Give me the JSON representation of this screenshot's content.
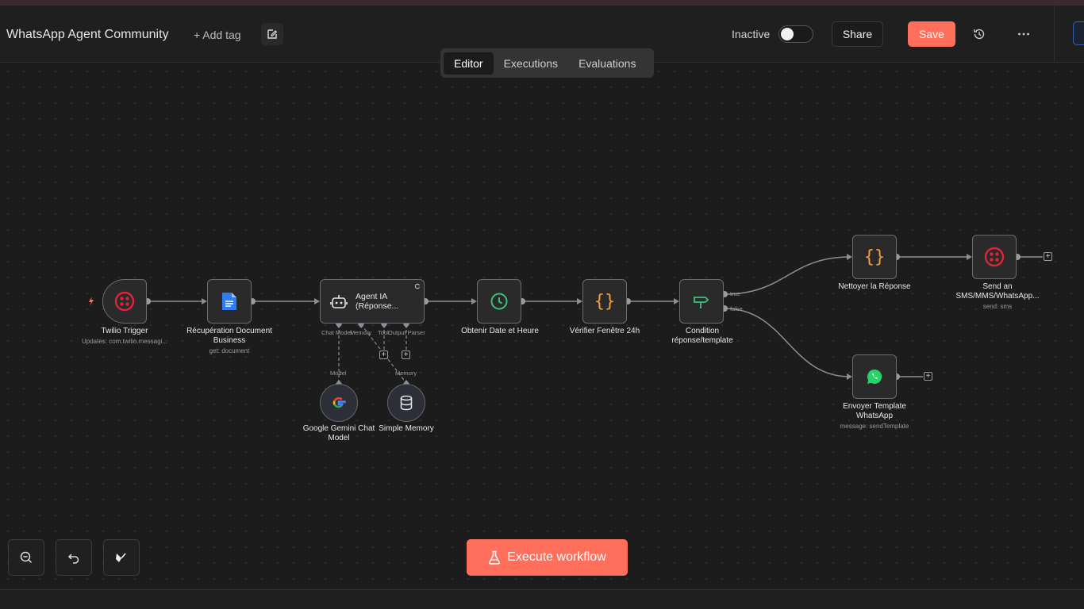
{
  "header": {
    "title": "WhatsApp Agent Community",
    "add_tag": "+ Add tag",
    "status": "Inactive",
    "share": "Share",
    "save": "Save"
  },
  "tabs": [
    "Editor",
    "Executions",
    "Evaluations"
  ],
  "nodes": {
    "twilio_trigger": {
      "label": "Twilio Trigger",
      "sub": "Updates: com.twilio.messagi..."
    },
    "recup_doc": {
      "label": "Récupération Document Business",
      "sub": "get: document"
    },
    "agent": {
      "label": "Agent IA (Réponse..."
    },
    "date": {
      "label": "Obtenir Date et Heure"
    },
    "verif": {
      "label": "Vérifier Fenêtre 24h"
    },
    "condition": {
      "label": "Condition réponse/template"
    },
    "nettoyer": {
      "label": "Nettoyer la Réponse"
    },
    "send": {
      "label": "Send an SMS/MMS/WhatsApp...",
      "sub": "send: sms"
    },
    "template": {
      "label": "Envoyer Template WhatsApp",
      "sub": "message: sendTemplate"
    },
    "gemini": {
      "label": "Google Gemini Chat Model"
    },
    "memory": {
      "label": "Simple Memory"
    }
  },
  "ports": {
    "chat_model": "Chat Model",
    "memory": "Memory",
    "tool": "Tool",
    "output_parser": "Output Parser",
    "model": "Model",
    "memory_lower": "Memory",
    "true": "true",
    "false": "false"
  },
  "execute": "Execute workflow",
  "colors": {
    "accent": "#ff6f5c",
    "twilio": "#e0233a",
    "json": "#f29c38",
    "clock": "#3fbf7f",
    "condition": "#3fbf7f",
    "whatsapp": "#25d366"
  }
}
